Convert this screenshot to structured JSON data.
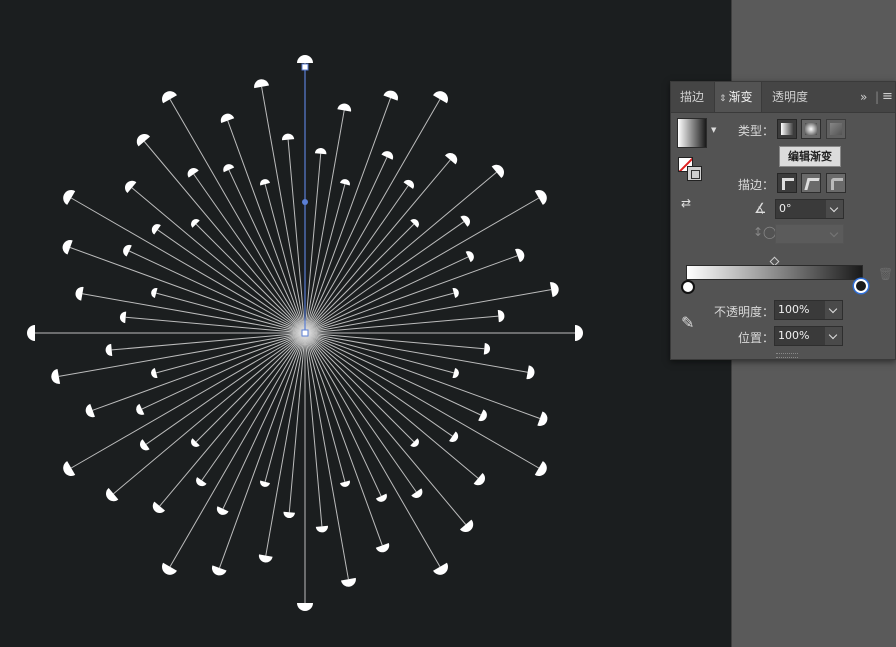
{
  "panel": {
    "tabs": [
      "描边",
      "渐变",
      "透明度"
    ],
    "active_tab": "渐变",
    "menu_chevrons": "»",
    "type_label": "类型：",
    "tooltip": "编辑渐变",
    "stroke_label": "描边：",
    "angle_value": "0°",
    "aspect_value": "",
    "opacity_label": "不透明度：",
    "opacity_value": "100%",
    "position_label": "位置：",
    "position_value": "100%"
  },
  "gradient": {
    "start_color": "#ffffff",
    "end_color": "#1a1a1a"
  },
  "canvas": {
    "background": "#1b1e1f",
    "line_color": "#d8d8d8",
    "selection_color": "#5b7fd6"
  }
}
